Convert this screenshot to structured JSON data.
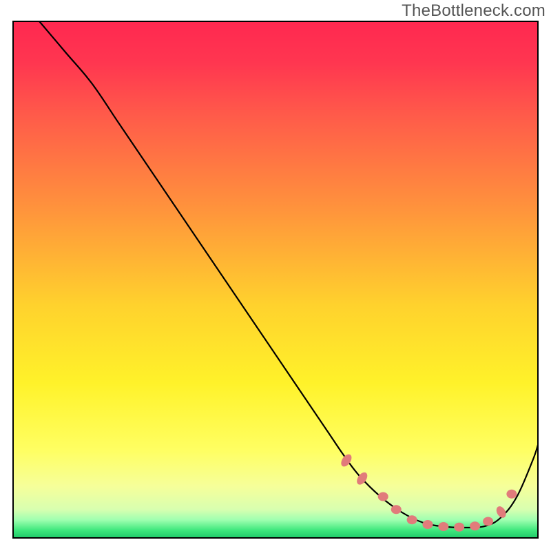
{
  "watermark": "TheBottleneck.com",
  "chart_data": {
    "type": "line",
    "title": "",
    "xlabel": "",
    "ylabel": "",
    "xlim": [
      0,
      100
    ],
    "ylim": [
      0,
      100
    ],
    "gradient_stops": [
      {
        "offset": 0.0,
        "color": "#ff2850"
      },
      {
        "offset": 0.08,
        "color": "#ff3650"
      },
      {
        "offset": 0.18,
        "color": "#ff5a4a"
      },
      {
        "offset": 0.35,
        "color": "#ff8f3d"
      },
      {
        "offset": 0.55,
        "color": "#ffd22d"
      },
      {
        "offset": 0.7,
        "color": "#fff22a"
      },
      {
        "offset": 0.83,
        "color": "#ffff62"
      },
      {
        "offset": 0.9,
        "color": "#f6ff9a"
      },
      {
        "offset": 0.945,
        "color": "#d8ffb0"
      },
      {
        "offset": 0.965,
        "color": "#9fffb0"
      },
      {
        "offset": 0.985,
        "color": "#3fe87d"
      },
      {
        "offset": 1.0,
        "color": "#1fc96a"
      }
    ],
    "series": [
      {
        "name": "bottleneck-curve",
        "x": [
          5,
          10,
          15,
          20,
          25,
          30,
          35,
          40,
          45,
          50,
          55,
          60,
          63,
          66,
          70,
          74,
          78,
          82,
          86,
          90,
          93,
          96,
          99,
          100
        ],
        "y": [
          100,
          94,
          88,
          80.5,
          73,
          65.5,
          58,
          50.5,
          43,
          35.5,
          28,
          20.5,
          16,
          12,
          8,
          5,
          3,
          2.2,
          2,
          2.3,
          4,
          8,
          15,
          18
        ]
      }
    ],
    "markers": {
      "name": "highlight-dots",
      "color": "#e17b7b",
      "points": [
        {
          "x": 63.5,
          "y": 15.0,
          "shape": "ellipse-45"
        },
        {
          "x": 66.5,
          "y": 11.5,
          "shape": "ellipse-45"
        },
        {
          "x": 70.5,
          "y": 8.0,
          "shape": "dot"
        },
        {
          "x": 73.0,
          "y": 5.5,
          "shape": "dot"
        },
        {
          "x": 76.0,
          "y": 3.5,
          "shape": "dot"
        },
        {
          "x": 79.0,
          "y": 2.6,
          "shape": "dot"
        },
        {
          "x": 82.0,
          "y": 2.2,
          "shape": "dot"
        },
        {
          "x": 85.0,
          "y": 2.1,
          "shape": "dot"
        },
        {
          "x": 88.0,
          "y": 2.3,
          "shape": "dot"
        },
        {
          "x": 90.5,
          "y": 3.2,
          "shape": "dot"
        },
        {
          "x": 93.0,
          "y": 5.0,
          "shape": "ellipse-60"
        },
        {
          "x": 95.0,
          "y": 8.5,
          "shape": "dot"
        }
      ]
    },
    "axis_box": {
      "stroke": "#000000",
      "stroke_width": 2
    }
  }
}
